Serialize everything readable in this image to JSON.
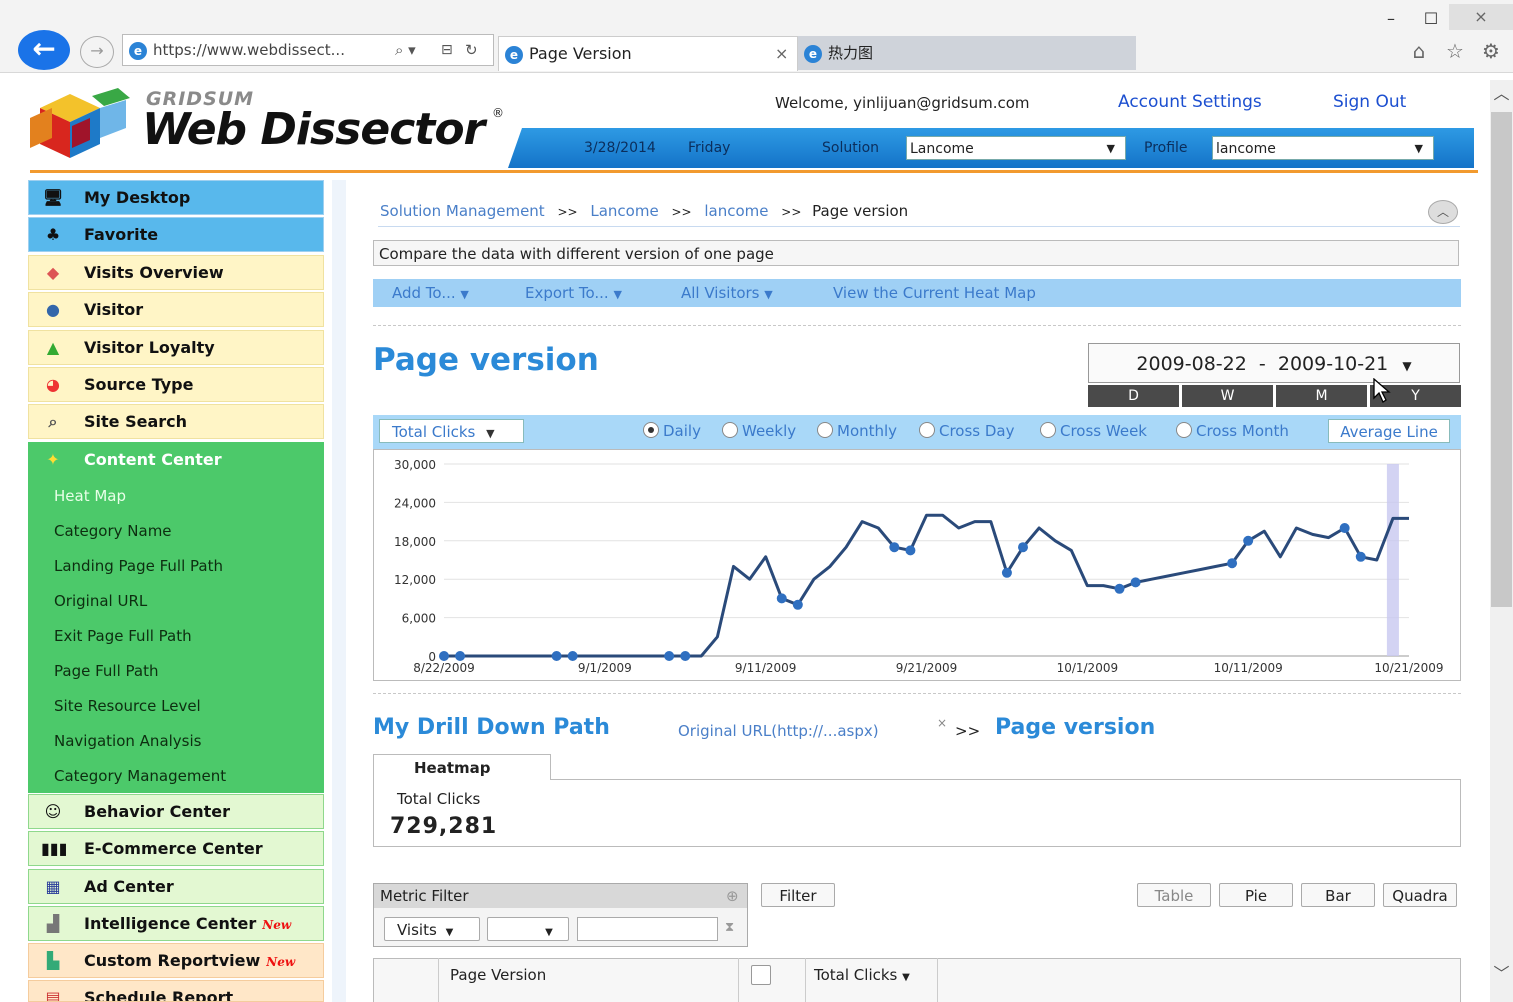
{
  "browser": {
    "url": "https://www.webdissect...",
    "tabs": [
      {
        "label": "Page Version",
        "close": "×"
      },
      {
        "label": "热力图"
      }
    ],
    "window_buttons": [
      "–",
      "☐",
      "×"
    ]
  },
  "header": {
    "brand_top": "GRIDSUM",
    "brand_main": "Web Dissector",
    "reg_mark": "®",
    "welcome": "Welcome, yinlijuan@gridsum.com",
    "account_settings": "Account Settings",
    "sign_out": "Sign Out",
    "date": "3/28/2014",
    "weekday": "Friday",
    "solution_label": "Solution",
    "solution_value": "Lancome",
    "profile_label": "Profile",
    "profile_value": "lancome"
  },
  "sidebar": {
    "items": [
      {
        "label": "My Desktop",
        "icon": "desktop-icon"
      },
      {
        "label": "Favorite",
        "icon": "favorite-icon"
      },
      {
        "label": "Visits Overview",
        "icon": "visits-icon"
      },
      {
        "label": "Visitor",
        "icon": "visitor-icon"
      },
      {
        "label": "Visitor Loyalty",
        "icon": "loyalty-icon"
      },
      {
        "label": "Source Type",
        "icon": "source-icon"
      },
      {
        "label": "Site Search",
        "icon": "search-icon"
      },
      {
        "label": "Content Center",
        "icon": "content-icon"
      }
    ],
    "content_sub": [
      "Heat Map",
      "Category Name",
      "Landing Page Full Path",
      "Original URL",
      "Exit Page Full Path",
      "Page Full Path",
      "Site Resource Level",
      "Navigation Analysis",
      "Category Management"
    ],
    "lower_items": [
      {
        "label": "Behavior Center",
        "icon": "behavior-icon",
        "tag": ""
      },
      {
        "label": "E-Commerce Center",
        "icon": "barcode-icon",
        "tag": ""
      },
      {
        "label": "Ad Center",
        "icon": "ad-icon",
        "tag": ""
      },
      {
        "label": "Intelligence Center",
        "icon": "intelligence-icon",
        "tag": "New"
      },
      {
        "label": "Custom Reportview",
        "icon": "report-icon",
        "tag": "New"
      },
      {
        "label": "Schedule Report",
        "icon": "schedule-icon",
        "tag": ""
      }
    ]
  },
  "breadcrumb": {
    "items": [
      "Solution Management",
      "Lancome",
      "lancome"
    ],
    "sep": ">>",
    "current": "Page version"
  },
  "description": "Compare the data with different version of one page",
  "toolbar": {
    "add_to": "Add To...",
    "export_to": "Export To...",
    "all_visitors": "All Visitors",
    "view_heatmap": "View the Current Heat Map"
  },
  "page_title": "Page version",
  "date_range": "2009-08-22  -  2009-10-21",
  "period_buttons": [
    "D",
    "W",
    "M",
    "Y"
  ],
  "chart_controls": {
    "metric": "Total Clicks",
    "radios": [
      {
        "label": "Daily",
        "on": true
      },
      {
        "label": "Weekly",
        "on": false
      },
      {
        "label": "Monthly",
        "on": false
      },
      {
        "label": "Cross Day",
        "on": false
      },
      {
        "label": "Cross Week",
        "on": false
      },
      {
        "label": "Cross Month",
        "on": false
      }
    ],
    "average_line": "Average Line"
  },
  "chart_data": {
    "type": "line",
    "title": "",
    "xlabel": "",
    "ylabel": "",
    "ylim": [
      0,
      30000
    ],
    "yticks": [
      "30,000",
      "24,000",
      "18,000",
      "12,000",
      "6,000",
      "0"
    ],
    "xticks": [
      "8/22/2009",
      "9/1/2009",
      "9/11/2009",
      "9/21/2009",
      "10/1/2009",
      "10/11/2009",
      "10/21/2009"
    ],
    "line_color": "#2a4a7a",
    "highlight_color": "#c8c8f0",
    "x": [
      "2009-08-22",
      "2009-08-23",
      "2009-08-24",
      "2009-08-25",
      "2009-08-26",
      "2009-08-27",
      "2009-08-28",
      "2009-08-29",
      "2009-08-30",
      "2009-08-31",
      "2009-09-01",
      "2009-09-02",
      "2009-09-03",
      "2009-09-04",
      "2009-09-05",
      "2009-09-06",
      "2009-09-07",
      "2009-09-08",
      "2009-09-09",
      "2009-09-10",
      "2009-09-11",
      "2009-09-12",
      "2009-09-13",
      "2009-09-14",
      "2009-09-15",
      "2009-09-16",
      "2009-09-17",
      "2009-09-18",
      "2009-09-19",
      "2009-09-20",
      "2009-09-21",
      "2009-09-22",
      "2009-09-23",
      "2009-09-24",
      "2009-09-25",
      "2009-09-26",
      "2009-09-27",
      "2009-09-28",
      "2009-09-29",
      "2009-09-30",
      "2009-10-01",
      "2009-10-02",
      "2009-10-03",
      "2009-10-04",
      "2009-10-05",
      "2009-10-06",
      "2009-10-07",
      "2009-10-08",
      "2009-10-09",
      "2009-10-10",
      "2009-10-11",
      "2009-10-12",
      "2009-10-13",
      "2009-10-14",
      "2009-10-15",
      "2009-10-16",
      "2009-10-17",
      "2009-10-18",
      "2009-10-19",
      "2009-10-20",
      "2009-10-21"
    ],
    "values": [
      0,
      0,
      0,
      0,
      0,
      0,
      0,
      0,
      0,
      0,
      0,
      0,
      0,
      0,
      0,
      0,
      0,
      3000,
      14000,
      12000,
      15500,
      9000,
      8000,
      12000,
      14000,
      17000,
      21000,
      20000,
      17000,
      16500,
      22000,
      22000,
      20000,
      21000,
      21000,
      13000,
      17000,
      20000,
      18000,
      16500,
      11000,
      11000,
      10500,
      11500,
      12000,
      12500,
      13000,
      13500,
      14000,
      14500,
      18000,
      19500,
      15500,
      20000,
      19000,
      18500,
      20000,
      15500,
      15000,
      21500,
      21500
    ],
    "markers": [
      "2009-08-22",
      "2009-08-23",
      "2009-08-29",
      "2009-08-30",
      "2009-09-05",
      "2009-09-06",
      "2009-09-12",
      "2009-09-13",
      "2009-09-19",
      "2009-09-20",
      "2009-09-26",
      "2009-09-27",
      "2009-10-03",
      "2009-10-04",
      "2009-10-10",
      "2009-10-11",
      "2009-10-17",
      "2009-10-18"
    ],
    "highlight_x": "2009-10-20"
  },
  "drill": {
    "title": "My Drill Down Path",
    "original_url": "Original URL(http://...aspx)",
    "remove": "×",
    "sep": ">>",
    "current": "Page version"
  },
  "heatmap": {
    "tab": "Heatmap",
    "metric_label": "Total Clicks",
    "metric_value": "729,281"
  },
  "filter": {
    "title": "Metric Filter",
    "metric": "Visits",
    "operator": "",
    "value": "",
    "filter_button": "Filter"
  },
  "view_buttons": [
    "Table",
    "Pie",
    "Bar",
    "Quadra"
  ],
  "grid": {
    "col_page_version": "Page Version",
    "col_total_clicks": "Total Clicks"
  }
}
